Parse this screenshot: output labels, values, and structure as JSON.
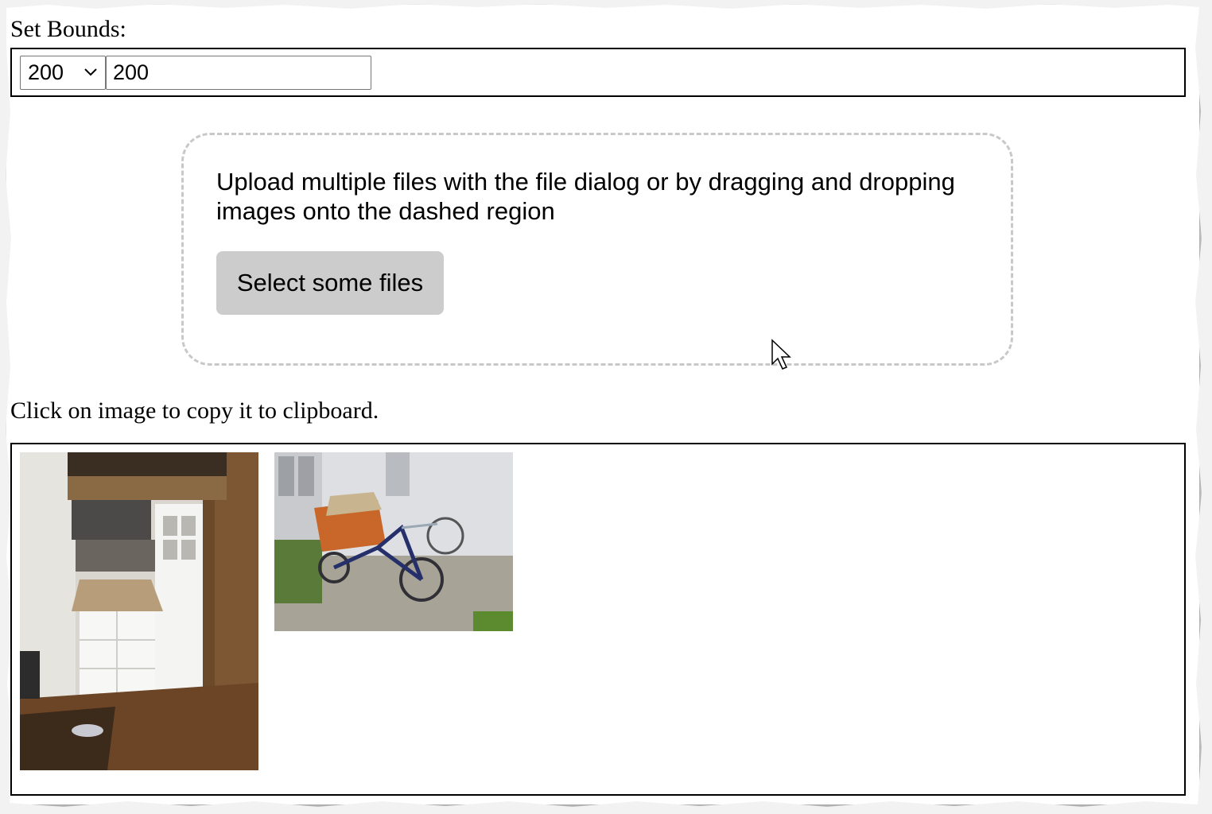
{
  "bounds": {
    "label": "Set Bounds:",
    "select_value": "200",
    "input_value": "200"
  },
  "upload": {
    "instructions": "Upload multiple files with the file dialog or by dragging and dropping images onto the dashed region",
    "button_label": "Select some files"
  },
  "gallery": {
    "hint": "Click on image to copy it to clipboard.",
    "images": [
      {
        "subject": "room-with-shelves-and-door"
      },
      {
        "subject": "cargo-bike-in-courtyard"
      }
    ]
  },
  "colors": {
    "dropzone_border": "#c8c8c8",
    "button_bg": "#cccccc"
  }
}
